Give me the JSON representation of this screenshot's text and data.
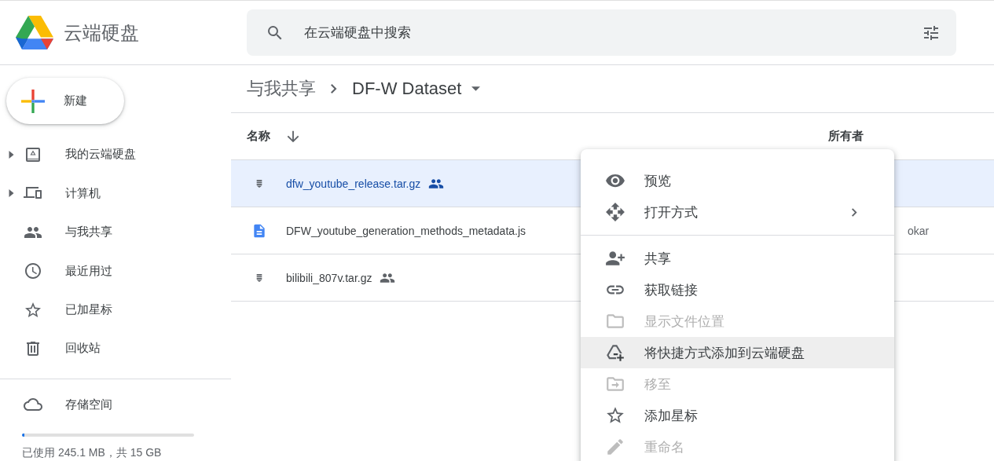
{
  "app": {
    "title": "云端硬盘"
  },
  "search": {
    "placeholder": "在云端硬盘中搜索"
  },
  "new_button": {
    "label": "新建"
  },
  "sidebar": {
    "items": [
      {
        "label": "我的云端硬盘",
        "kind": "drive",
        "expandable": true,
        "selected": false
      },
      {
        "label": "计算机",
        "kind": "computer",
        "expandable": true,
        "selected": false
      },
      {
        "label": "与我共享",
        "kind": "people",
        "expandable": false,
        "selected": false
      },
      {
        "label": "最近用过",
        "kind": "clock",
        "expandable": false,
        "selected": false
      },
      {
        "label": "已加星标",
        "kind": "star",
        "expandable": false,
        "selected": false
      },
      {
        "label": "回收站",
        "kind": "trash",
        "expandable": false,
        "selected": false
      }
    ]
  },
  "storage": {
    "label": "存储空间",
    "level": 0.015,
    "usage": "已使用 245.1 MB，共 15 GB"
  },
  "breadcrumb": [
    {
      "label": "与我共享",
      "dropdown": false
    },
    {
      "label": "DF-W Dataset",
      "dropdown": true
    }
  ],
  "table": {
    "columns": [
      {
        "label": "名称",
        "sorted": true
      },
      {
        "label": "所有者",
        "sorted": false
      }
    ],
    "rows": [
      {
        "name": "dfw_youtube_release.tar.gz",
        "kind": "archive",
        "shared": true,
        "selected": true
      },
      {
        "name": "DFW_youtube_generation_methods_metadata.js",
        "kind": "document",
        "shared": false,
        "selected": false,
        "owner": "okar"
      },
      {
        "name": "bilibili_807v.tar.gz",
        "kind": "archive",
        "shared": true,
        "selected": false
      }
    ]
  },
  "context_menu": {
    "items": [
      {
        "label": "预览",
        "kind": "eye",
        "disabled": false,
        "highlighted": false,
        "submenu": false,
        "divider_before": false
      },
      {
        "label": "打开方式",
        "kind": "move",
        "disabled": false,
        "highlighted": false,
        "submenu": true,
        "divider_before": false
      },
      {
        "label": "共享",
        "kind": "person-add",
        "disabled": false,
        "highlighted": false,
        "submenu": false,
        "divider_before": true
      },
      {
        "label": "获取链接",
        "kind": "link",
        "disabled": false,
        "highlighted": false,
        "submenu": false,
        "divider_before": false
      },
      {
        "label": "显示文件位置",
        "kind": "folder",
        "disabled": true,
        "highlighted": false,
        "submenu": false,
        "divider_before": false
      },
      {
        "label": "将快捷方式添加到云端硬盘",
        "kind": "drive-add",
        "disabled": false,
        "highlighted": true,
        "submenu": false,
        "divider_before": false
      },
      {
        "label": "移至",
        "kind": "folder-move",
        "disabled": true,
        "highlighted": false,
        "submenu": false,
        "divider_before": false
      },
      {
        "label": "添加星标",
        "kind": "star",
        "disabled": false,
        "highlighted": false,
        "submenu": false,
        "divider_before": false
      },
      {
        "label": "重命名",
        "kind": "pencil",
        "disabled": true,
        "highlighted": false,
        "submenu": false,
        "divider_before": false
      }
    ]
  }
}
